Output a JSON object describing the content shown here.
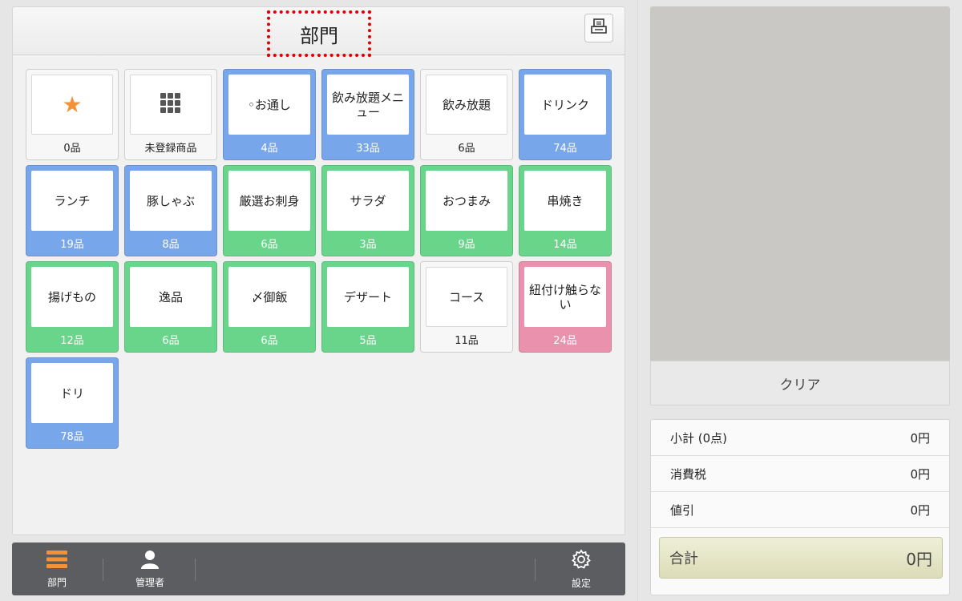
{
  "header": {
    "title": "部門"
  },
  "tiles": [
    {
      "label": "",
      "icon": "star-icon",
      "count": "0品",
      "color": "white"
    },
    {
      "label": "",
      "icon": "keypad-icon",
      "count": "未登録商品",
      "color": "white"
    },
    {
      "label": "◦お通し",
      "count": "4品",
      "color": "blue"
    },
    {
      "label": "飲み放題メニュー",
      "count": "33品",
      "color": "blue"
    },
    {
      "label": "飲み放題",
      "count": "6品",
      "color": "white"
    },
    {
      "label": "ドリンク",
      "count": "74品",
      "color": "blue"
    },
    {
      "label": "ランチ",
      "count": "19品",
      "color": "blue"
    },
    {
      "label": "豚しゃぶ",
      "count": "8品",
      "color": "blue"
    },
    {
      "label": "厳選お刺身",
      "count": "6品",
      "color": "green"
    },
    {
      "label": "サラダ",
      "count": "3品",
      "color": "green"
    },
    {
      "label": "おつまみ",
      "count": "9品",
      "color": "green"
    },
    {
      "label": "串焼き",
      "count": "14品",
      "color": "green"
    },
    {
      "label": "揚げもの",
      "count": "12品",
      "color": "green"
    },
    {
      "label": "逸品",
      "count": "6品",
      "color": "green"
    },
    {
      "label": "〆御飯",
      "count": "6品",
      "color": "green"
    },
    {
      "label": "デザート",
      "count": "5品",
      "color": "green"
    },
    {
      "label": "コース",
      "count": "11品",
      "color": "white"
    },
    {
      "label": "紐付け触らない",
      "count": "24品",
      "color": "pink"
    },
    {
      "label": "ドリ",
      "count": "78品",
      "color": "blue"
    }
  ],
  "toolbar": {
    "department_label": "部門",
    "admin_label": "管理者",
    "settings_label": "設定"
  },
  "clear_label": "クリア",
  "summary": {
    "subtotal_label": "小計 (0点)",
    "subtotal_value": "0円",
    "tax_label": "消費税",
    "tax_value": "0円",
    "discount_label": "値引",
    "discount_value": "0円",
    "total_label": "合計",
    "total_value": "0円"
  },
  "colors": {
    "blue": "#78a6ea",
    "green": "#69d58a",
    "pink": "#ea91ae",
    "accent": "#f39236"
  }
}
